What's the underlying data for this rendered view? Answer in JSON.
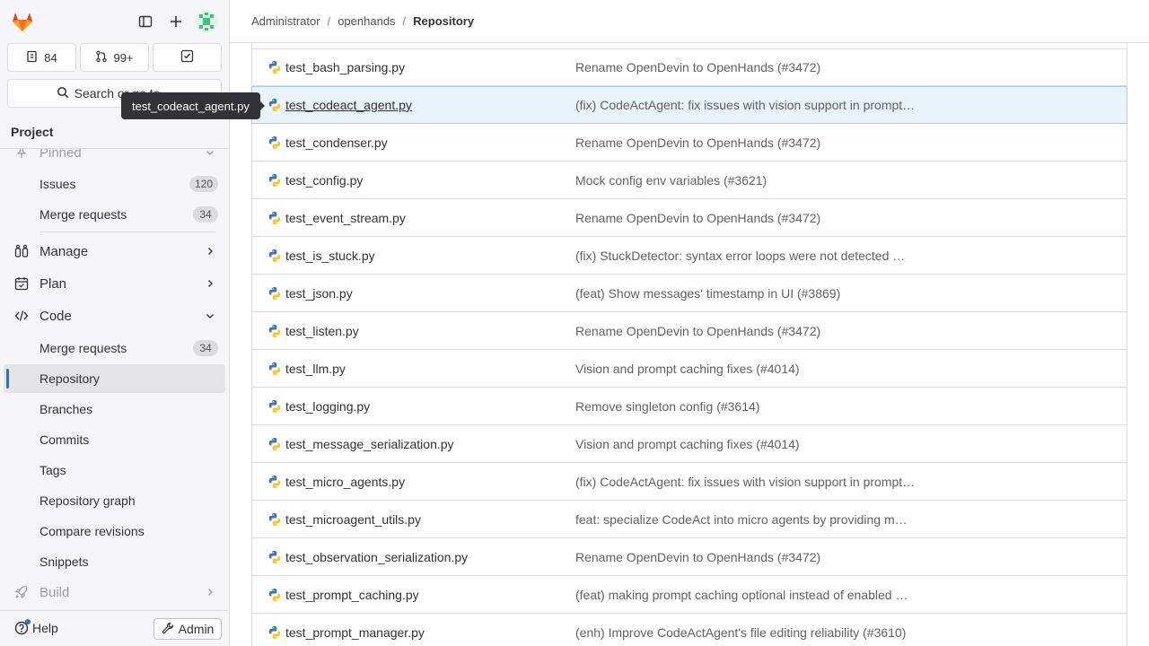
{
  "sidebar": {
    "counters": {
      "issues": "84",
      "merge_requests": "99+"
    },
    "search_label": "Search or go to…",
    "project_header": "Project",
    "pinned_label": "Pinned",
    "pinned_items": [
      {
        "label": "Issues",
        "count": "120"
      },
      {
        "label": "Merge requests",
        "count": "34"
      }
    ],
    "sections": {
      "manage": "Manage",
      "plan": "Plan",
      "code": "Code",
      "build": "Build"
    },
    "code_items": [
      {
        "label": "Merge requests",
        "count": "34"
      },
      {
        "label": "Repository"
      },
      {
        "label": "Branches"
      },
      {
        "label": "Commits"
      },
      {
        "label": "Tags"
      },
      {
        "label": "Repository graph"
      },
      {
        "label": "Compare revisions"
      },
      {
        "label": "Snippets"
      }
    ],
    "help_label": "Help",
    "admin_label": "Admin"
  },
  "tooltip": "test_codeact_agent.py",
  "breadcrumb": [
    "Administrator",
    "openhands",
    "Repository"
  ],
  "files": [
    {
      "name": "test_bash_parsing.py",
      "commit": "Rename OpenDevin to OpenHands (#3472)"
    },
    {
      "name": "test_codeact_agent.py",
      "commit": "(fix) CodeActAgent: fix issues with vision support in prompt…"
    },
    {
      "name": "test_condenser.py",
      "commit": "Rename OpenDevin to OpenHands (#3472)"
    },
    {
      "name": "test_config.py",
      "commit": "Mock config env variables (#3621)"
    },
    {
      "name": "test_event_stream.py",
      "commit": "Rename OpenDevin to OpenHands (#3472)"
    },
    {
      "name": "test_is_stuck.py",
      "commit": "(fix) StuckDetector: syntax error loops were not detected …"
    },
    {
      "name": "test_json.py",
      "commit": "(feat) Show messages' timestamp in UI (#3869)"
    },
    {
      "name": "test_listen.py",
      "commit": "Rename OpenDevin to OpenHands (#3472)"
    },
    {
      "name": "test_llm.py",
      "commit": "Vision and prompt caching fixes (#4014)"
    },
    {
      "name": "test_logging.py",
      "commit": "Remove singleton config (#3614)"
    },
    {
      "name": "test_message_serialization.py",
      "commit": "Vision and prompt caching fixes (#4014)"
    },
    {
      "name": "test_micro_agents.py",
      "commit": "(fix) CodeActAgent: fix issues with vision support in prompt…"
    },
    {
      "name": "test_microagent_utils.py",
      "commit": "feat: specialize CodeAct into micro agents by providing m…"
    },
    {
      "name": "test_observation_serialization.py",
      "commit": "Rename OpenDevin to OpenHands (#3472)"
    },
    {
      "name": "test_prompt_caching.py",
      "commit": "(feat) making prompt caching optional instead of enabled …"
    },
    {
      "name": "test_prompt_manager.py",
      "commit": "(enh) Improve CodeActAgent's file editing reliability (#3610)"
    }
  ],
  "colors": {
    "accent": "#1f75cb",
    "hover_row": "#e9f3fc",
    "logo_orange": "#fc6d26"
  },
  "icons": [
    "gitlab-logo-icon",
    "sidebar-toggle-icon",
    "plus-icon",
    "issues-icon",
    "merge-request-icon",
    "todo-icon",
    "search-icon",
    "pin-icon",
    "manage-icon",
    "plan-icon",
    "code-icon",
    "build-icon",
    "chevron-right-icon",
    "chevron-down-icon",
    "help-icon",
    "wrench-icon",
    "python-file-icon"
  ]
}
